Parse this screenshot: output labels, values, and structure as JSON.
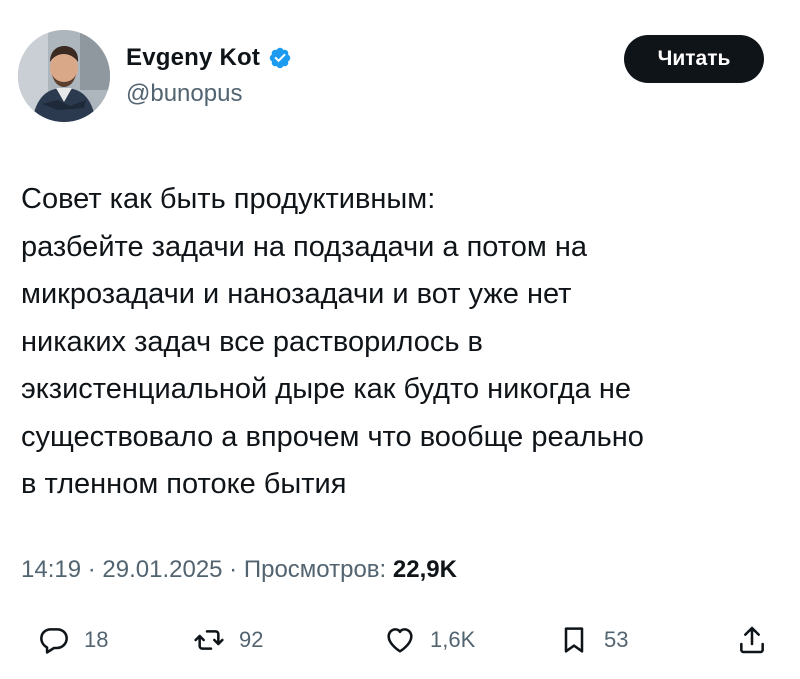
{
  "author": {
    "name": "Evgeny Kot",
    "handle": "@bunopus",
    "verified": true
  },
  "follow_button": {
    "label": "Читать"
  },
  "tweet": {
    "lines": [
      "Совет как быть продуктивным:",
      "разбейте задачи на подзадачи а потом на",
      "микрозадачи и нанозадачи и вот уже нет",
      "никаких задач все растворилось в",
      "экзистенциальной дыре как будто никогда не",
      "существовало а впрочем что вообще реально",
      "в тленном потоке бытия"
    ]
  },
  "meta": {
    "time": "14:19",
    "separator": " · ",
    "date": "29.01.2025",
    "views_label": "Просмотров:",
    "views_count": "22,9K"
  },
  "actions": {
    "replies": "18",
    "retweets": "92",
    "likes": "1,6K",
    "bookmarks": "53"
  },
  "colors": {
    "text": "#0f1419",
    "secondary": "#536471",
    "verified": "#1d9bf0",
    "button_bg": "#0f1419",
    "button_text": "#ffffff"
  },
  "icons": {
    "reply": "speech-bubble-icon",
    "retweet": "retweet-arrows-icon",
    "like": "heart-icon",
    "bookmark": "bookmark-icon",
    "share": "share-upload-icon",
    "verified": "verified-badge-icon"
  }
}
